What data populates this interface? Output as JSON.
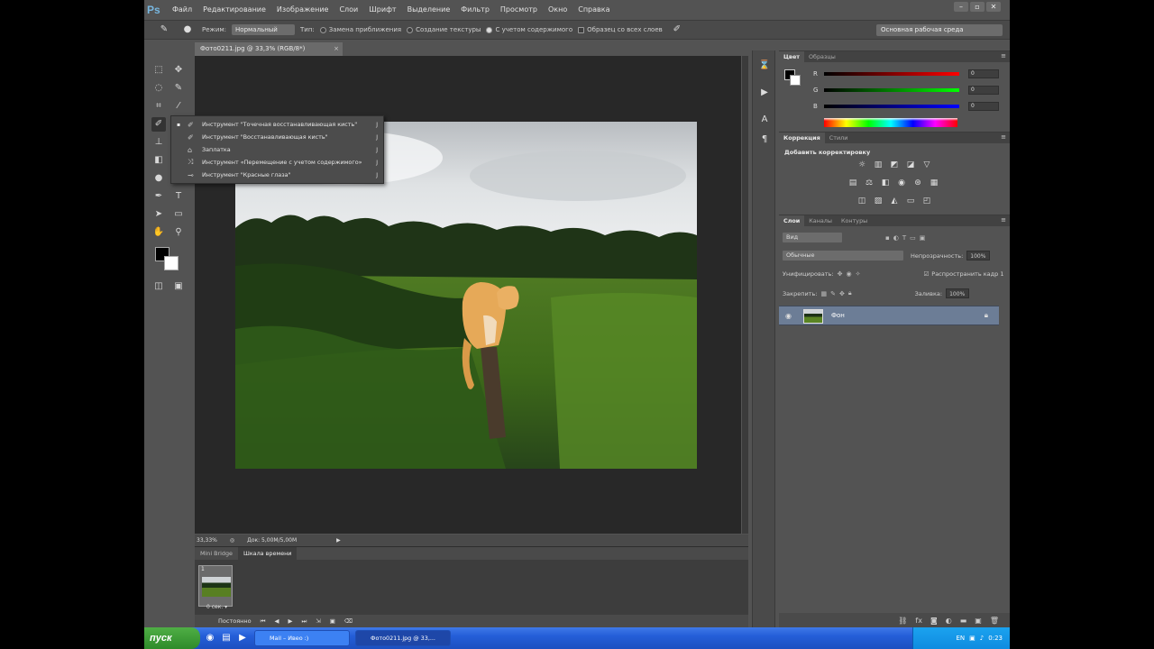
{
  "app": {
    "logo": "Ps",
    "menu": [
      "Файл",
      "Редактирование",
      "Изображение",
      "Слои",
      "Шрифт",
      "Выделение",
      "Фильтр",
      "Просмотр",
      "Окно",
      "Справка"
    ],
    "window_controls": [
      "–",
      "▫",
      "✕"
    ]
  },
  "options": {
    "mode_label": "Режим:",
    "mode_value": "Нормальный",
    "type_label": "Тип:",
    "radio1": "Замена приближения",
    "radio2": "Создание текстуры",
    "radio3": "С учетом содержимого",
    "sample_all": "Образец со всех слоев",
    "workspace": "Основная рабочая среда"
  },
  "document": {
    "tab_title": "Фото0211.jpg @ 33,3% (RGB/8*)",
    "close": "×",
    "status_zoom": "33,33%",
    "status_doc": "Док: 5,00M/5,00M"
  },
  "flyout": {
    "items": [
      {
        "label": "Инструмент \"Точечная восстанавливающая кисть\"",
        "key": "J",
        "active": true
      },
      {
        "label": "Инструмент \"Восстанавливающая кисть\"",
        "key": "J",
        "active": false
      },
      {
        "label": "Заплатка",
        "key": "J",
        "active": false
      },
      {
        "label": "Инструмент «Перемещение с учетом содержимого»",
        "key": "J",
        "active": false
      },
      {
        "label": "Инструмент \"Красные глаза\"",
        "key": "J",
        "active": false
      }
    ]
  },
  "timeline": {
    "tab1": "Mini Bridge",
    "tab2": "Шкала времени",
    "frame_number": "1",
    "frame_delay": "0 сек. ▾",
    "loop": "Постоянно"
  },
  "panels": {
    "color_tabs": [
      "Цвет",
      "Образцы"
    ],
    "channels": [
      {
        "label": "R",
        "value": "0"
      },
      {
        "label": "G",
        "value": "0"
      },
      {
        "label": "B",
        "value": "0"
      }
    ],
    "adj_tabs": [
      "Коррекция",
      "Стили"
    ],
    "adj_title": "Добавить корректировку",
    "layers_tabs": [
      "Слои",
      "Каналы",
      "Контуры"
    ],
    "layers_kind": "Вид",
    "layers_blend": "Обычные",
    "opacity_label": "Непрозрачность:",
    "opacity_value": "100%",
    "unify_label": "Унифицировать:",
    "propagate_label": "Распространить кадр 1",
    "lock_label": "Закрепить:",
    "fill_label": "Заливка:",
    "fill_value": "100%",
    "layer_name": "Фон"
  },
  "taskbar": {
    "start": "пуск",
    "task1": "Mail – Ивео :)",
    "task2": "Фото0211.jpg @ 33,...",
    "clock": "0:23"
  },
  "colors": {
    "ui_bg": "#535353",
    "canvas_bg": "#282828",
    "layer_selected": "#6c7d96",
    "taskbar_blue": "#245ed8"
  }
}
